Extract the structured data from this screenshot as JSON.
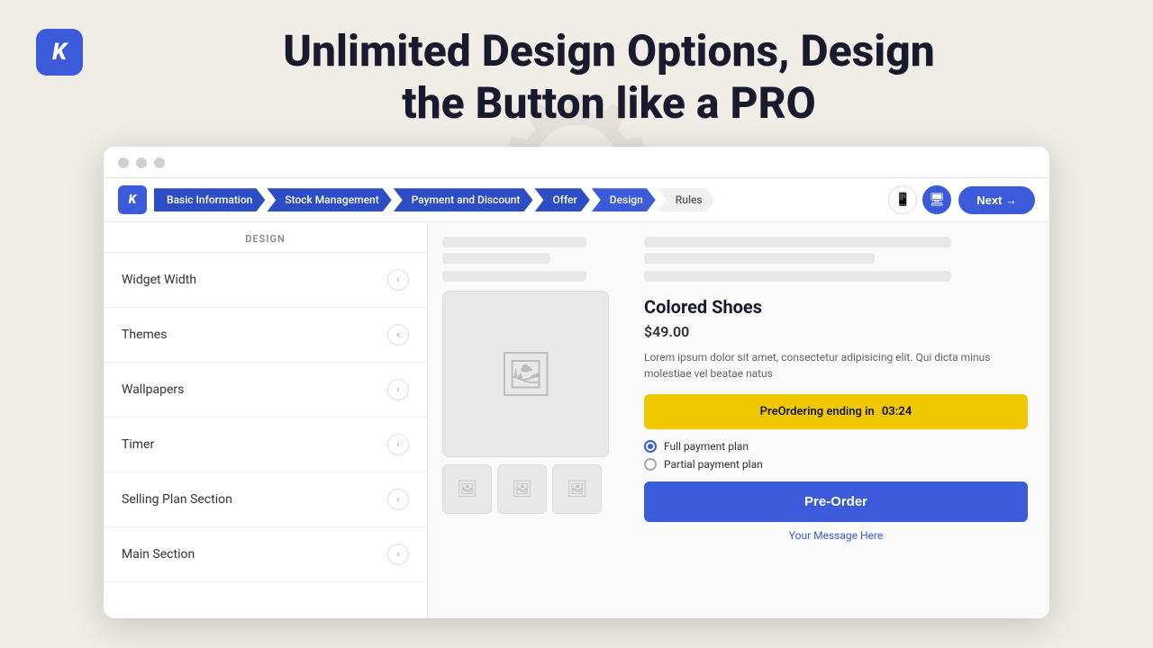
{
  "page": {
    "headline_line1": "Unlimited Design Options, Design",
    "headline_line2": "the Button like a PRO"
  },
  "logo": {
    "letter": "K"
  },
  "nav": {
    "steps": [
      {
        "label": "Basic Information",
        "state": "completed"
      },
      {
        "label": "Stock Management",
        "state": "completed"
      },
      {
        "label": "Payment and Discount",
        "state": "completed"
      },
      {
        "label": "Offer",
        "state": "completed"
      },
      {
        "label": "Design",
        "state": "active"
      },
      {
        "label": "Rules",
        "state": "default"
      }
    ],
    "next_label": "Next →"
  },
  "sidebar": {
    "title": "DESIGN",
    "items": [
      {
        "label": "Widget Width"
      },
      {
        "label": "Themes"
      },
      {
        "label": "Wallpapers"
      },
      {
        "label": "Timer"
      },
      {
        "label": "Selling Plan Section"
      },
      {
        "label": "Main Section"
      }
    ]
  },
  "preview": {
    "product_name": "Colored Shoes",
    "product_price": "$49.00",
    "product_desc": "Lorem ipsum dolor sit amet, consectetur adipisicing elit. Qui dicta minus molestiae vel beatae natus",
    "preorder_banner_text": "PreOrdering ending in",
    "preorder_timer": "03:24",
    "payment_options": [
      {
        "label": "Full payment plan",
        "selected": true
      },
      {
        "label": "Partial payment plan",
        "selected": false
      }
    ],
    "preorder_button": "Pre-Order",
    "your_message": "Your Message Here"
  },
  "window_dots": [
    "dot1",
    "dot2",
    "dot3"
  ]
}
